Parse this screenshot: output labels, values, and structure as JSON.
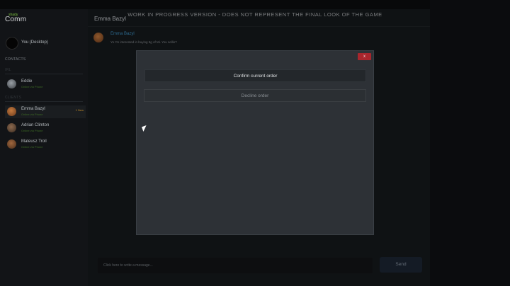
{
  "app": {
    "logo_small": "shady",
    "logo_main": "Comm",
    "watermark": "WORK IN PROGRESS VERSION - DOES NOT REPRESENT THE FINAL LOOK OF THE GAME"
  },
  "sidebar": {
    "me_label": "You (Desktop)",
    "contacts_label": "CONTACTS",
    "section_a_label": "IRL",
    "section_b_label": "CLIENTS",
    "contacts": [
      {
        "name": "Eddie",
        "status": "Online via Phone",
        "badge": ""
      },
      {
        "name": "Emma Bazyl",
        "status": "Online via Phone",
        "badge": "1 New"
      },
      {
        "name": "Adrian Climton",
        "status": "Online via Phone",
        "badge": ""
      },
      {
        "name": "Mateusz Troll",
        "status": "Online via Phone",
        "badge": ""
      }
    ]
  },
  "chat": {
    "title": "Emma Bazyl",
    "message": {
      "sender": "Emma Bazyl",
      "text": "Yo I'm interested in buying 5g of Mi. You sellin?"
    },
    "input_placeholder": "Click here to write a message...",
    "send_label": "Send"
  },
  "modal": {
    "close_label": "x",
    "confirm_label": "Confirm current order",
    "decline_label": "Decline order"
  },
  "colors": {
    "accent_link": "#3c8fc1",
    "close_red": "#a8262d",
    "status_green": "#3d6b24",
    "badge_orange": "#c08a27"
  }
}
